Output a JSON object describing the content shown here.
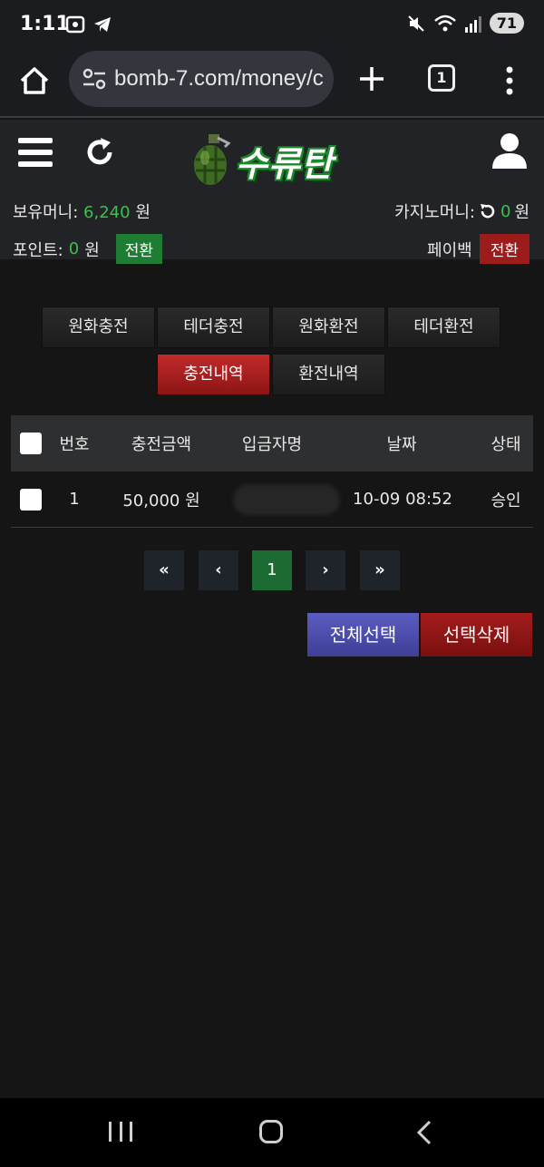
{
  "status_bar": {
    "time": "1:11",
    "battery": "71",
    "icons": [
      "screenshot-icon",
      "telegram-icon",
      "mute-icon",
      "wifi-icon",
      "signal-icon"
    ]
  },
  "browser": {
    "url": "bomb-7.com/money/c",
    "tab_count": "1"
  },
  "site": {
    "logo_text": "수류탄",
    "money_label": "보유머니:",
    "money_value": "6,240",
    "money_unit": "원",
    "casino_label": "카지노머니:",
    "casino_value": "0",
    "casino_unit": "원",
    "point_label": "포인트:",
    "point_value": "0",
    "point_unit": "원",
    "convert_label": "전환",
    "payback_label": "페이백",
    "payback_convert_label": "전환"
  },
  "tabs": [
    {
      "label": "원화충전",
      "active": false
    },
    {
      "label": "테더충전",
      "active": false
    },
    {
      "label": "원화환전",
      "active": false
    },
    {
      "label": "테더환전",
      "active": false
    },
    {
      "label": "충전내역",
      "active": true
    },
    {
      "label": "환전내역",
      "active": false
    }
  ],
  "table": {
    "headers": [
      "번호",
      "충전금액",
      "입금자명",
      "날짜",
      "상태"
    ],
    "rows": [
      {
        "no": "1",
        "amount": "50,000 원",
        "depositor": "",
        "date": "10-09 08:52",
        "status": "승인"
      }
    ]
  },
  "pagination": {
    "first": "«",
    "prev": "‹",
    "current": "1",
    "next": "›",
    "last": "»"
  },
  "actions": {
    "select_all": "전체선택",
    "delete_selected": "선택삭제"
  },
  "colors": {
    "accent_green": "#3fbf4f",
    "active_red": "#c22a2a",
    "select_all_blue": "#5b5cc2"
  }
}
